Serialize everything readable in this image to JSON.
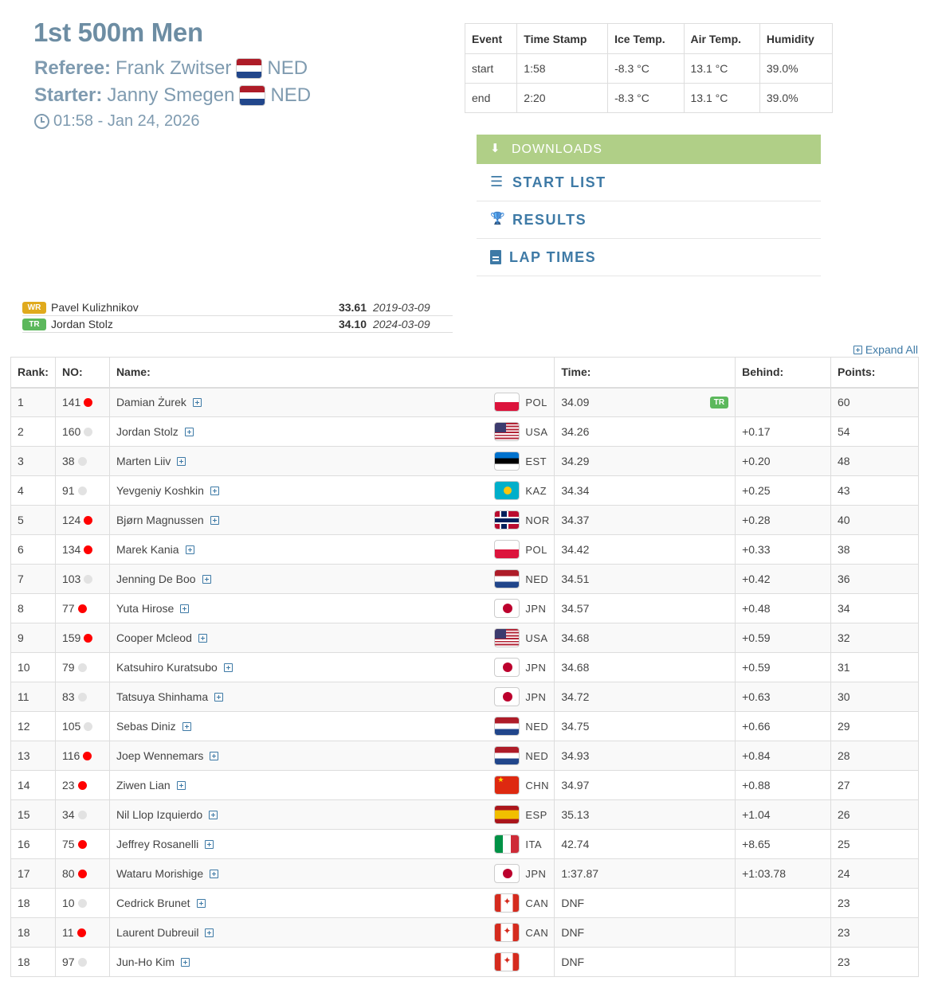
{
  "event": {
    "title": "1st 500m Men",
    "referee_label": "Referee:",
    "referee_name": "Frank Zwitser",
    "referee_country": "NED",
    "starter_label": "Starter:",
    "starter_name": "Janny Smegen",
    "starter_country": "NED",
    "datetime": "01:58 - Jan 24, 2026"
  },
  "conditions": {
    "headers": [
      "Event",
      "Time Stamp",
      "Ice Temp.",
      "Air Temp.",
      "Humidity"
    ],
    "rows": [
      [
        "start",
        "1:58",
        "-8.3 °C",
        "13.1 °C",
        "39.0%"
      ],
      [
        "end",
        "2:20",
        "-8.3 °C",
        "13.1 °C",
        "39.0%"
      ]
    ]
  },
  "downloads": {
    "header": "DOWNLOADS",
    "items": [
      "START LIST",
      "RESULTS",
      "LAP TIMES"
    ]
  },
  "records": [
    {
      "badge": "WR",
      "name": "Pavel Kulizhnikov",
      "time": "33.61",
      "date": "2019-03-09"
    },
    {
      "badge": "TR",
      "name": "Jordan Stolz",
      "time": "34.10",
      "date": "2024-03-09"
    }
  ],
  "expand_all": "Expand All",
  "results": {
    "headers": [
      "Rank:",
      "NO:",
      "Name:",
      "Time:",
      "Behind:",
      "Points:"
    ],
    "rows": [
      {
        "rank": "1",
        "no": "141",
        "dot": "red",
        "name": "Damian Żurek",
        "nat": "POL",
        "time": "34.09",
        "badge": "TR",
        "behind": "",
        "points": "60"
      },
      {
        "rank": "2",
        "no": "160",
        "dot": "grey",
        "name": "Jordan Stolz",
        "nat": "USA",
        "time": "34.26",
        "badge": "",
        "behind": "+0.17",
        "points": "54"
      },
      {
        "rank": "3",
        "no": "38",
        "dot": "grey",
        "name": "Marten Liiv",
        "nat": "EST",
        "time": "34.29",
        "badge": "",
        "behind": "+0.20",
        "points": "48"
      },
      {
        "rank": "4",
        "no": "91",
        "dot": "grey",
        "name": "Yevgeniy Koshkin",
        "nat": "KAZ",
        "time": "34.34",
        "badge": "",
        "behind": "+0.25",
        "points": "43"
      },
      {
        "rank": "5",
        "no": "124",
        "dot": "red",
        "name": "Bjørn Magnussen",
        "nat": "NOR",
        "time": "34.37",
        "badge": "",
        "behind": "+0.28",
        "points": "40"
      },
      {
        "rank": "6",
        "no": "134",
        "dot": "red",
        "name": "Marek Kania",
        "nat": "POL",
        "time": "34.42",
        "badge": "",
        "behind": "+0.33",
        "points": "38"
      },
      {
        "rank": "7",
        "no": "103",
        "dot": "grey",
        "name": "Jenning De Boo",
        "nat": "NED",
        "time": "34.51",
        "badge": "",
        "behind": "+0.42",
        "points": "36"
      },
      {
        "rank": "8",
        "no": "77",
        "dot": "red",
        "name": "Yuta Hirose",
        "nat": "JPN",
        "time": "34.57",
        "badge": "",
        "behind": "+0.48",
        "points": "34"
      },
      {
        "rank": "9",
        "no": "159",
        "dot": "red",
        "name": "Cooper Mcleod",
        "nat": "USA",
        "time": "34.68",
        "badge": "",
        "behind": "+0.59",
        "points": "32"
      },
      {
        "rank": "10",
        "no": "79",
        "dot": "grey",
        "name": "Katsuhiro Kuratsubo",
        "nat": "JPN",
        "time": "34.68",
        "badge": "",
        "behind": "+0.59",
        "points": "31"
      },
      {
        "rank": "11",
        "no": "83",
        "dot": "grey",
        "name": "Tatsuya Shinhama",
        "nat": "JPN",
        "time": "34.72",
        "badge": "",
        "behind": "+0.63",
        "points": "30"
      },
      {
        "rank": "12",
        "no": "105",
        "dot": "grey",
        "name": "Sebas Diniz",
        "nat": "NED",
        "time": "34.75",
        "badge": "",
        "behind": "+0.66",
        "points": "29"
      },
      {
        "rank": "13",
        "no": "116",
        "dot": "red",
        "name": "Joep Wennemars",
        "nat": "NED",
        "time": "34.93",
        "badge": "",
        "behind": "+0.84",
        "points": "28"
      },
      {
        "rank": "14",
        "no": "23",
        "dot": "red",
        "name": "Ziwen Lian",
        "nat": "CHN",
        "time": "34.97",
        "badge": "",
        "behind": "+0.88",
        "points": "27"
      },
      {
        "rank": "15",
        "no": "34",
        "dot": "grey",
        "name": "Nil Llop Izquierdo",
        "nat": "ESP",
        "time": "35.13",
        "badge": "",
        "behind": "+1.04",
        "points": "26"
      },
      {
        "rank": "16",
        "no": "75",
        "dot": "red",
        "name": "Jeffrey Rosanelli",
        "nat": "ITA",
        "time": "42.74",
        "badge": "",
        "behind": "+8.65",
        "points": "25"
      },
      {
        "rank": "17",
        "no": "80",
        "dot": "red",
        "name": "Wataru Morishige",
        "nat": "JPN",
        "time": "1:37.87",
        "badge": "",
        "behind": "+1:03.78",
        "points": "24"
      },
      {
        "rank": "18",
        "no": "10",
        "dot": "grey",
        "name": "Cedrick Brunet",
        "nat": "CAN",
        "time": "DNF",
        "badge": "",
        "behind": "",
        "points": "23"
      },
      {
        "rank": "18",
        "no": "11",
        "dot": "red",
        "name": "Laurent Dubreuil",
        "nat": "CAN",
        "time": "DNF",
        "badge": "",
        "behind": "",
        "points": "23"
      },
      {
        "rank": "18",
        "no": "97",
        "dot": "grey",
        "name": "Jun-Ho Kim",
        "nat": "",
        "time": "DNF",
        "badge": "",
        "behind": "",
        "points": "23"
      }
    ]
  }
}
